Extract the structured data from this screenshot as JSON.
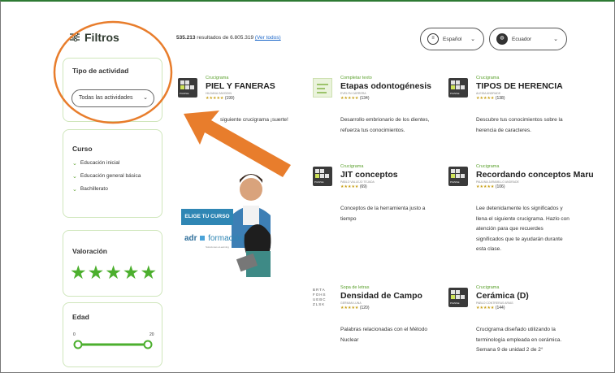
{
  "sidebar": {
    "title": "Filtros",
    "activity": {
      "heading": "Tipo de actividad",
      "selected": "Todas las actividades"
    },
    "course": {
      "heading": "Curso",
      "items": [
        "Educación inicial",
        "Educación general básica",
        "Bachillerato"
      ]
    },
    "rating": {
      "heading": "Valoración",
      "stars": "★★★★★"
    },
    "age": {
      "heading": "Edad",
      "min_label": "0",
      "max_label": "20",
      "min": 0,
      "max": 20
    }
  },
  "results": {
    "count": "535.213",
    "text": " resultados de 6.805.319 ",
    "link": "(Ver todos)"
  },
  "filters": {
    "language": {
      "icon": "chat-icon",
      "value": "Español"
    },
    "country": {
      "icon": "globe-icon",
      "value": "Ecuador"
    }
  },
  "items": [
    {
      "category": "Crucigrama",
      "title": "PIEL Y FANERAS",
      "author": "HILDANA ZAVIDDIN",
      "rating": "(199)",
      "description": "siguiente crucigrama ¡suerte!"
    },
    {
      "category": "Completar texto",
      "title": "Etapas odontogénesis",
      "author": "EVELYN CARRERA",
      "rating": "(134)",
      "description": "Desarrollo embrionario de los dientes, refuerza tus conocimientos."
    },
    {
      "category": "Crucigrama",
      "title": "TIPOS DE HERENCIA",
      "author": "ALEIDA ANDRADE",
      "rating": "(138)",
      "description": "Descubre tus conocimientos sobre la herencia de caracteres."
    },
    {
      "category": "Crucigrama",
      "title": "JIT conceptos",
      "author": "PABLO VALLEJO TEJADA",
      "rating": "(69)",
      "description": "Conceptos de la herramienta justo a tiempo"
    },
    {
      "category": "Crucigrama",
      "title": "Recordando conceptos Maru",
      "author": "PAULINA JARAMILLO ANDRADE",
      "rating": "(106)",
      "description": "Lee detenidamente los significados y llena el siguiente crucigrama. Hazlo con atención para que recuerdes significados que te ayudarán durante esta clase."
    },
    {
      "category": "Sopa de letras",
      "title": "Densidad de Campo",
      "author": "GERMAN LUNA",
      "rating": "(120)",
      "description": "Palabras relacionadas con el Método Nuclear"
    },
    {
      "category": "Crucigrama",
      "title": "Cerámica (D)",
      "author": "PABLO CONTRERAS ARIAS",
      "rating": "(144)",
      "description": "Crucigrama diseñado utilizando la terminología empleada en cerámica. Semana 9 de unidad 2 de 2°"
    }
  ],
  "rating_stars": "★★★★★",
  "thumb_caption": "PUZZLE",
  "ad": {
    "button": "ELIGE TU CURSO",
    "brand": "adr",
    "brand2": "formación",
    "tagline": "Soluciones eLearning"
  },
  "colors": {
    "accent": "#4caf2e",
    "annotation": "#e87d2c"
  }
}
